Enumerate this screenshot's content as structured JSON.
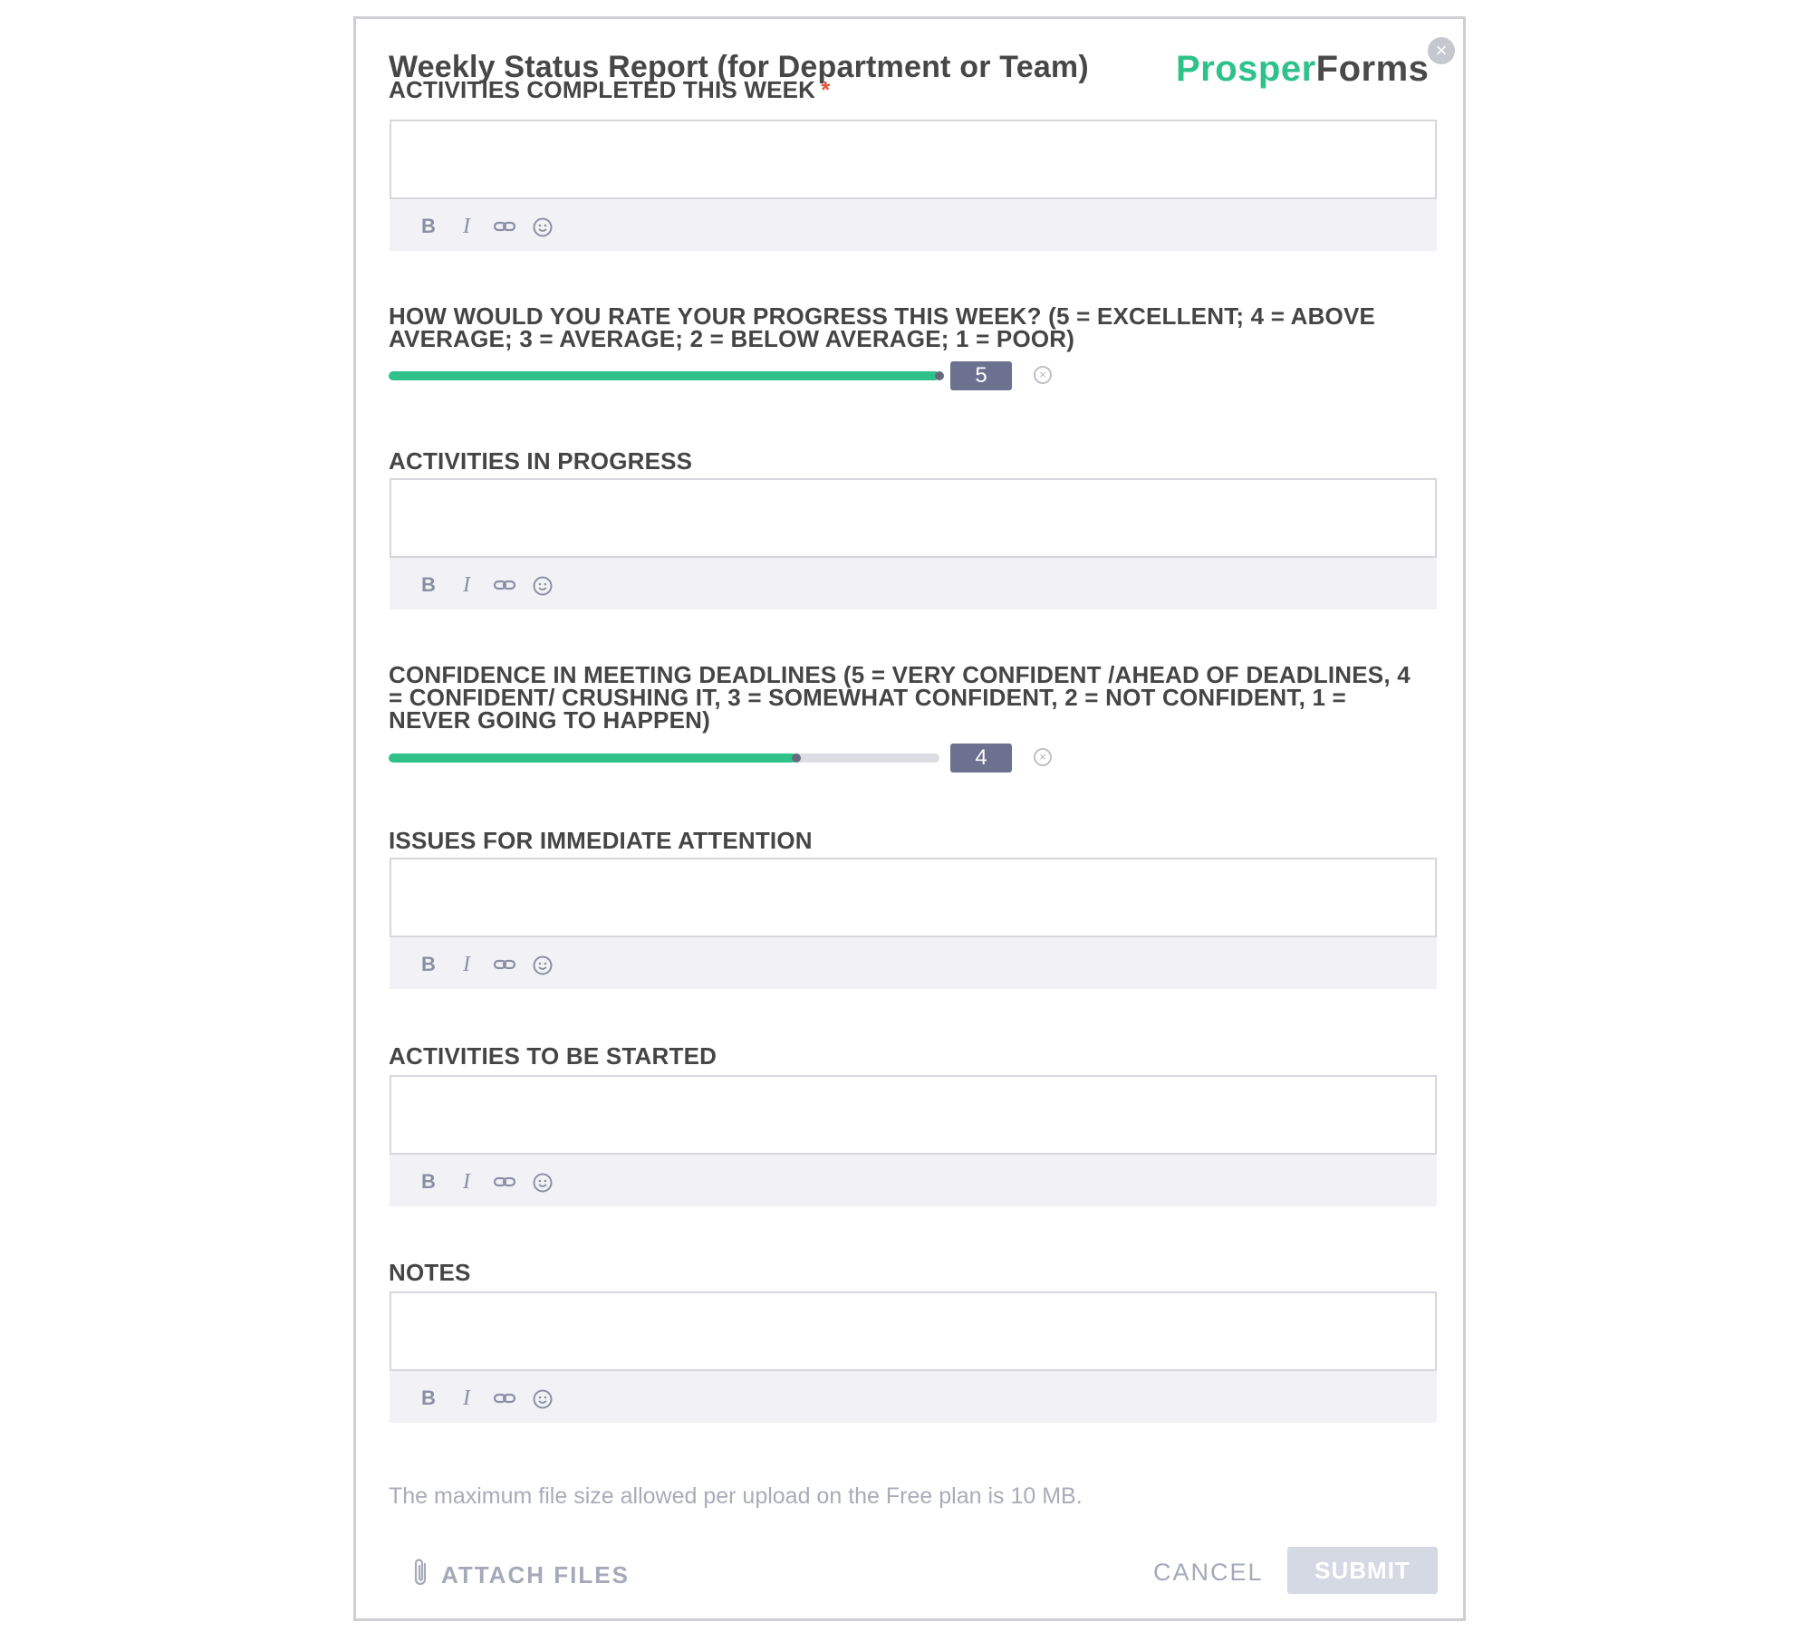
{
  "form": {
    "title": "Weekly Status Report (for Department or Team)",
    "logo": {
      "part1": "Prosper",
      "part2": "Forms"
    },
    "close_icon": "close-icon",
    "colors": {
      "accent": "#2ec28a",
      "badge": "#6b718e",
      "required": "#e5533d"
    }
  },
  "fields": {
    "completed": {
      "label": "ACTIVITIES COMPLETED THIS WEEK",
      "required_mark": "*",
      "value": ""
    },
    "rating_progress": {
      "label": "HOW WOULD YOU RATE YOUR PROGRESS THIS WEEK? (5 = EXCELLENT; 4 = ABOVE AVERAGE; 3 = AVERAGE; 2 = BELOW AVERAGE; 1 = POOR)",
      "value": 5,
      "value_text": "5",
      "min": 1,
      "max": 5,
      "fill_fraction": 1.0
    },
    "in_progress": {
      "label": "ACTIVITIES IN PROGRESS",
      "value": ""
    },
    "rating_confidence": {
      "label": "CONFIDENCE IN MEETING DEADLINES (5 = VERY CONFIDENT /AHEAD OF DEADLINES, 4 = CONFIDENT/ CRUSHING IT, 3 = SOMEWHAT CONFIDENT, 2 = NOT CONFIDENT, 1 = NEVER GOING TO HAPPEN)",
      "value": 4,
      "value_text": "4",
      "min": 1,
      "max": 5,
      "fill_fraction": 0.74
    },
    "issues": {
      "label": "ISSUES FOR IMMEDIATE ATTENTION",
      "value": ""
    },
    "to_be_started": {
      "label": "ACTIVITIES TO BE STARTED",
      "value": ""
    },
    "notes": {
      "label": "NOTES",
      "value": ""
    }
  },
  "toolbar": {
    "bold": "B",
    "italic": "I",
    "icons": [
      "bold-icon",
      "italic-icon",
      "link-icon",
      "emoji-icon"
    ]
  },
  "footer": {
    "file_note": "The maximum file size allowed per upload on the Free plan is 10 MB.",
    "attach_label": "ATTACH FILES",
    "cancel_label": "CANCEL",
    "submit_label": "SUBMIT"
  }
}
